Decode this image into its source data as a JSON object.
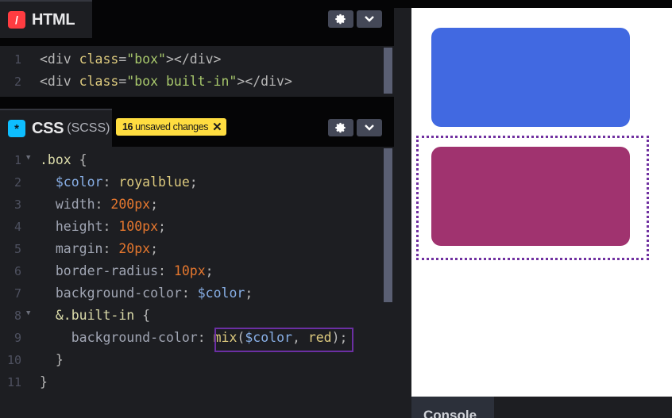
{
  "html_pane": {
    "title": "HTML",
    "icon": "html-slash-icon",
    "icon_glyph": "/",
    "lines": [
      {
        "n": "1",
        "parts": [
          [
            "t-tag",
            "<div "
          ],
          [
            "t-attr",
            "class"
          ],
          [
            "t-tag",
            "="
          ],
          [
            "t-str",
            "\"box\""
          ],
          [
            "t-tag",
            "></div>"
          ]
        ]
      },
      {
        "n": "2",
        "parts": [
          [
            "t-tag",
            "<div "
          ],
          [
            "t-attr",
            "class"
          ],
          [
            "t-tag",
            "="
          ],
          [
            "t-str",
            "\"box built-in\""
          ],
          [
            "t-tag",
            "></div>"
          ]
        ]
      }
    ]
  },
  "css_pane": {
    "title": "CSS",
    "subtitle": "(SCSS)",
    "icon": "css-asterisk-icon",
    "icon_glyph": "*",
    "badge_count": "16",
    "badge_text": "unsaved changes",
    "badge_close": "✕",
    "lines": [
      {
        "n": "1",
        "fold": true,
        "parts": [
          [
            "t-sel",
            ".box "
          ],
          [
            "t-tag",
            "{"
          ]
        ]
      },
      {
        "n": "2",
        "fold": false,
        "parts": [
          [
            "t-tag",
            "  "
          ],
          [
            "t-var",
            "$color"
          ],
          [
            "t-tag",
            ": "
          ],
          [
            "t-kw",
            "royalblue"
          ],
          [
            "t-tag",
            ";"
          ]
        ]
      },
      {
        "n": "3",
        "fold": false,
        "parts": [
          [
            "t-tag",
            "  "
          ],
          [
            "t-prop",
            "width"
          ],
          [
            "t-tag",
            ": "
          ],
          [
            "t-num",
            "200px"
          ],
          [
            "t-tag",
            ";"
          ]
        ]
      },
      {
        "n": "4",
        "fold": false,
        "parts": [
          [
            "t-tag",
            "  "
          ],
          [
            "t-prop",
            "height"
          ],
          [
            "t-tag",
            ": "
          ],
          [
            "t-num",
            "100px"
          ],
          [
            "t-tag",
            ";"
          ]
        ]
      },
      {
        "n": "5",
        "fold": false,
        "parts": [
          [
            "t-tag",
            "  "
          ],
          [
            "t-prop",
            "margin"
          ],
          [
            "t-tag",
            ": "
          ],
          [
            "t-num",
            "20px"
          ],
          [
            "t-tag",
            ";"
          ]
        ]
      },
      {
        "n": "6",
        "fold": false,
        "parts": [
          [
            "t-tag",
            "  "
          ],
          [
            "t-prop",
            "border-radius"
          ],
          [
            "t-tag",
            ": "
          ],
          [
            "t-num",
            "10px"
          ],
          [
            "t-tag",
            ";"
          ]
        ]
      },
      {
        "n": "7",
        "fold": false,
        "parts": [
          [
            "t-tag",
            "  "
          ],
          [
            "t-prop",
            "background-color"
          ],
          [
            "t-tag",
            ": "
          ],
          [
            "t-var",
            "$color"
          ],
          [
            "t-tag",
            ";"
          ]
        ]
      },
      {
        "n": "8",
        "fold": true,
        "parts": [
          [
            "t-tag",
            "  "
          ],
          [
            "t-sel",
            "&.built-in "
          ],
          [
            "t-tag",
            "{"
          ]
        ]
      },
      {
        "n": "9",
        "fold": false,
        "parts": [
          [
            "t-tag",
            "    "
          ],
          [
            "t-prop",
            "background-color"
          ],
          [
            "t-tag",
            ": "
          ],
          [
            "t-fn",
            "mix"
          ],
          [
            "t-tag",
            "("
          ],
          [
            "t-var",
            "$color"
          ],
          [
            "t-tag",
            ", "
          ],
          [
            "t-kw",
            "red"
          ],
          [
            "t-tag",
            ");"
          ]
        ]
      },
      {
        "n": "10",
        "fold": false,
        "parts": [
          [
            "t-tag",
            "  }"
          ]
        ]
      },
      {
        "n": "11",
        "fold": false,
        "parts": [
          [
            "t-tag",
            "}"
          ]
        ]
      }
    ]
  },
  "controls": {
    "settings_icon": "gear-icon",
    "collapse_icon": "chevron-down-icon"
  },
  "preview": {
    "box1_color": "#4169e1",
    "box2_color": "#a0336f"
  },
  "console": {
    "label": "Console"
  }
}
